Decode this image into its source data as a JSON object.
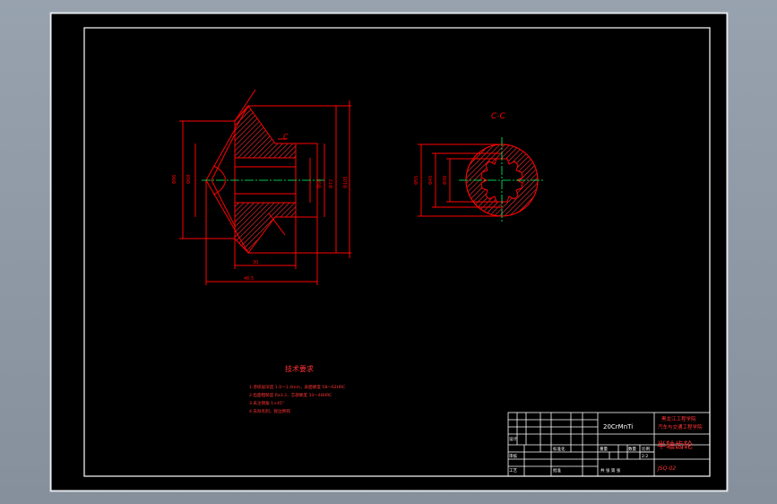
{
  "view": {
    "section_label": "C-C",
    "cut_marker": "C"
  },
  "tech_notes": {
    "title": "技术要求",
    "items": [
      "1.渗碳层深度 1.0～1.4mm，表面硬度 58～62HRC",
      "2.齿面粗糙度 Ra3.2，芯部硬度 33～48HRC",
      "3.未注倒角 1×45°",
      "4.去除毛刺，锐边倒钝"
    ]
  },
  "title_block": {
    "material": "20CrMnTi",
    "school_line1": "黑龙江工程学院",
    "school_line2": "汽车与交通工程学院",
    "part_name": "半轴齿轮",
    "scale_label": "比例",
    "scale_value": "2:2",
    "quantity_label": "数量",
    "weight_label": "重量",
    "drawing_no": "JSQ-02",
    "row_designer": "设计",
    "row_checker": "审核",
    "row_process": "工艺",
    "row_standard": "标准化",
    "row_approve": "批准",
    "sheets_label": "共 张 第 张"
  },
  "colors": {
    "background": "#000000",
    "frame": "#ffffff",
    "geometry": "#ff0000",
    "centerline": "#00ff66",
    "hatch": "#ff3333"
  }
}
